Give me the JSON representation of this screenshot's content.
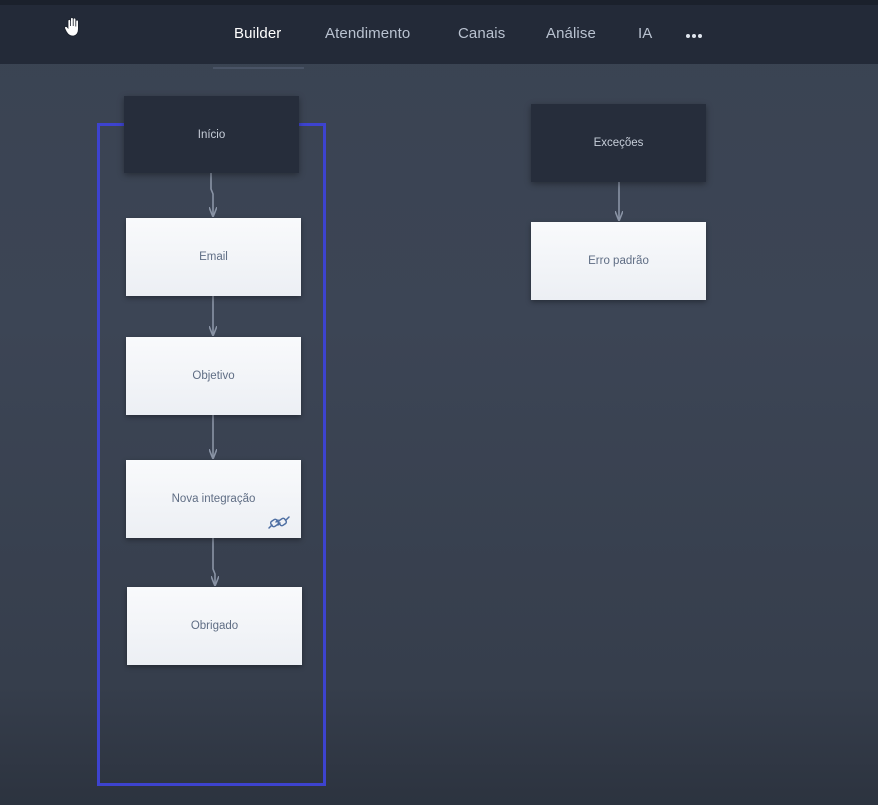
{
  "nav": {
    "items": [
      {
        "label": "Builder",
        "active": true
      },
      {
        "label": "Atendimento",
        "active": false
      },
      {
        "label": "Canais",
        "active": false
      },
      {
        "label": "Análise",
        "active": false
      },
      {
        "label": "IA",
        "active": false
      }
    ],
    "more_icon": "more-horizontal-icon",
    "hand_icon": "hand-cursor-icon"
  },
  "flow": {
    "main": {
      "start": "Início",
      "steps": [
        "Email",
        "Objetivo",
        "Nova integração",
        "Obrigado"
      ],
      "integration_icon": "link-icon"
    },
    "exceptions": {
      "start": "Exceções",
      "steps": [
        "Erro padrão"
      ]
    }
  },
  "colors": {
    "selection": "#3d43cf",
    "dark_node": "#262d3b",
    "light_node": "#f4f6f9",
    "connector": "#8a94a6"
  }
}
